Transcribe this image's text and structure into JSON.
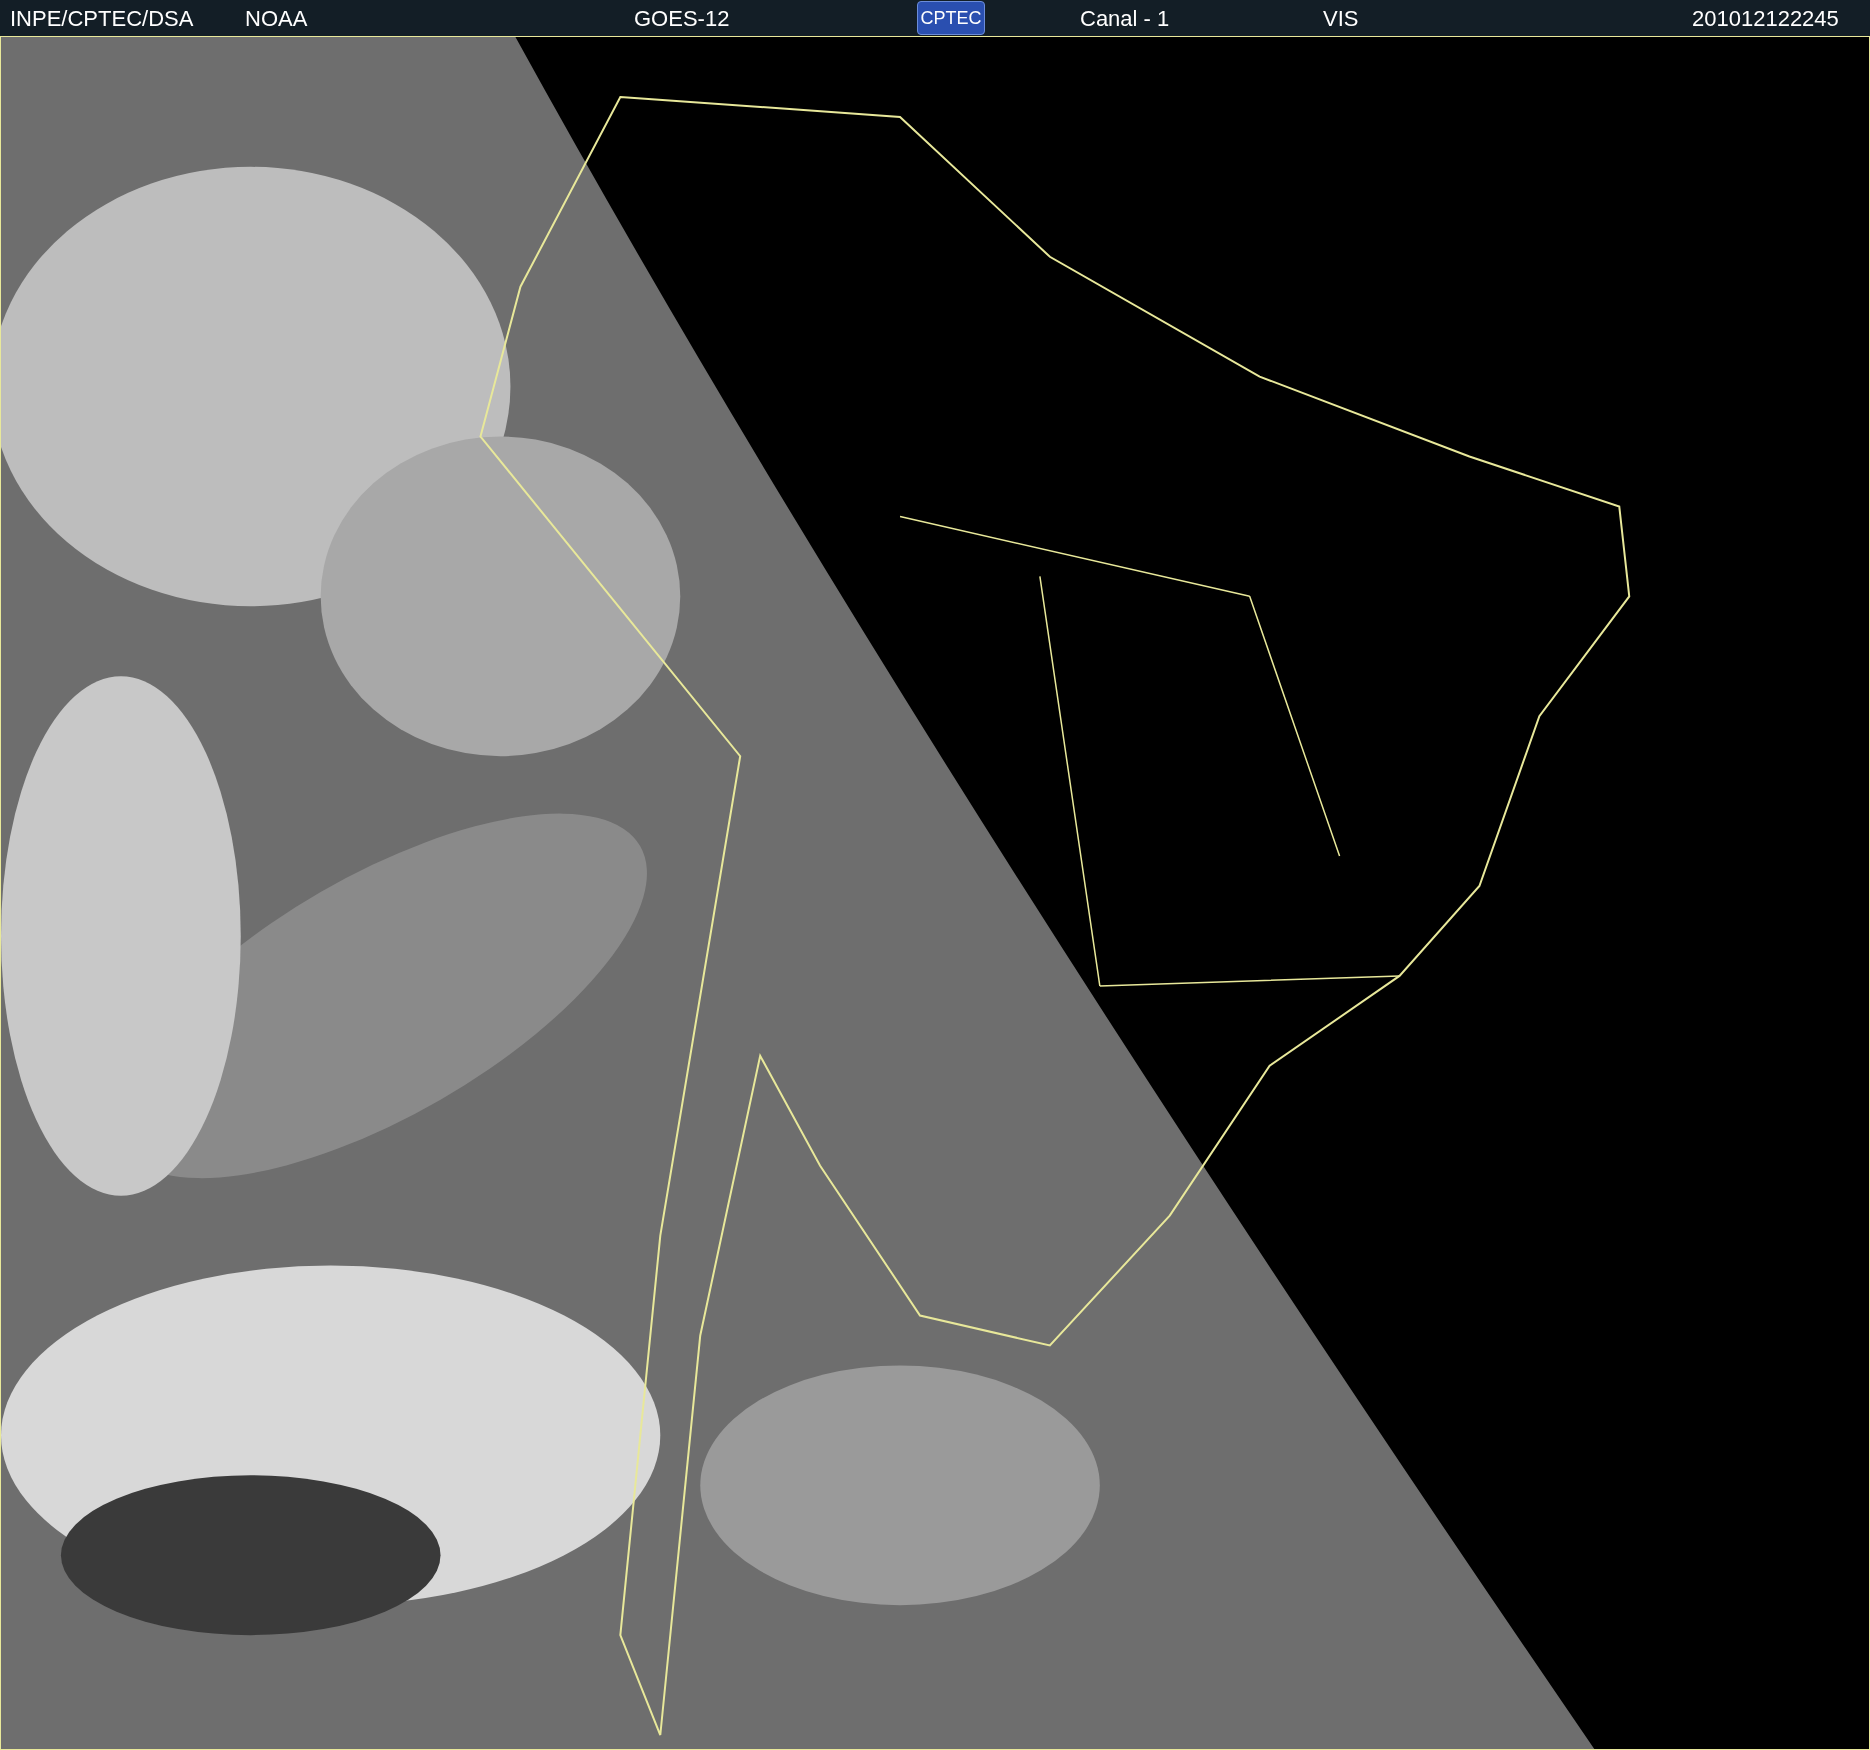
{
  "header": {
    "source": "INPE/CPTEC/DSA",
    "agency": "NOAA",
    "satellite": "GOES-12",
    "logo": "CPTEC",
    "channel": "Canal - 1",
    "band": "VIS",
    "timestamp": "201012122245"
  }
}
